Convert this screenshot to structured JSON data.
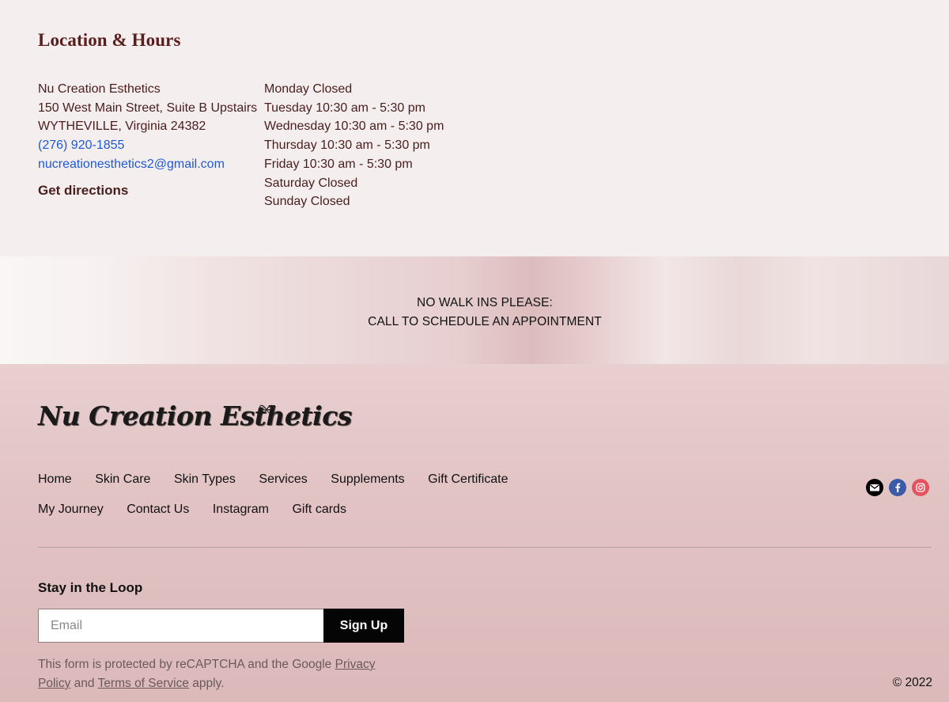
{
  "location": {
    "title": "Location & Hours",
    "address": {
      "business_name": "Nu Creation Esthetics",
      "street": "150 West Main Street, Suite B Upstairs",
      "city_line": "WYTHEVILLE, Virginia 24382",
      "phone": "(276) 920-1855",
      "email": "nucreationesthetics2@gmail.com",
      "directions_label": "Get directions"
    },
    "hours": [
      "Monday Closed",
      "Tuesday 10:30 am - 5:30 pm",
      "Wednesday 10:30 am - 5:30 pm",
      "Thursday 10:30 am - 5:30 pm",
      "Friday 10:30 am - 5:30 pm",
      "Saturday Closed",
      "Sunday Closed"
    ],
    "link_color": "#1d5ad8"
  },
  "notice": {
    "line1": "NO WALK INS PLEASE:",
    "line2": "CALL TO SCHEDULE AN APPOINTMENT"
  },
  "footer": {
    "logo_text": "Nu Creation Esthetics",
    "nav_row1": [
      "Home",
      "Skin Care",
      "Skin Types",
      "Services",
      "Supplements",
      "Gift Certificate"
    ],
    "nav_row2": [
      "My Journey",
      "Contact Us",
      "Instagram",
      "Gift cards"
    ],
    "social": [
      {
        "name": "email",
        "icon": "envelope-icon",
        "color": "#000000"
      },
      {
        "name": "facebook",
        "icon": "facebook-icon",
        "color": "#3b5aa8"
      },
      {
        "name": "instagram",
        "icon": "instagram-icon",
        "color": "#e4535f"
      }
    ],
    "newsletter": {
      "title": "Stay in the Loop",
      "email_placeholder": "Email",
      "email_value": "",
      "button_label": "Sign Up"
    },
    "recaptcha": {
      "prefix": "This form is protected by reCAPTCHA and the Google ",
      "privacy_label": "Privacy Policy",
      "middle": " and ",
      "terms_label": "Terms of Service",
      "suffix": " apply."
    },
    "copyright": "© 2022"
  }
}
